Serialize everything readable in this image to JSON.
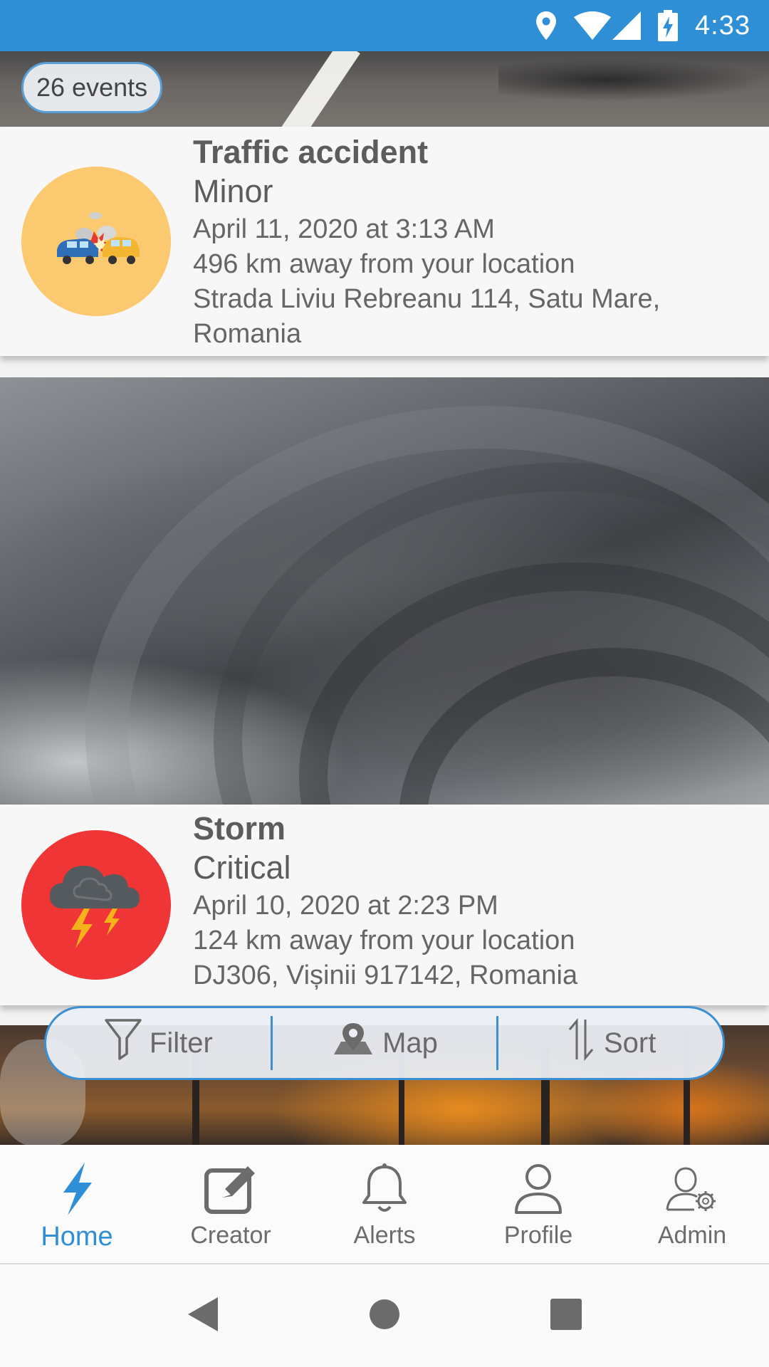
{
  "status_bar": {
    "time": "4:33",
    "icons": [
      "location-icon",
      "wifi-icon",
      "signal-icon",
      "battery-charging-icon"
    ],
    "background": "#2f8fd6"
  },
  "events_count": "26 events",
  "cards": [
    {
      "title": "Traffic accident",
      "severity": "Minor",
      "datetime": "April 11, 2020 at 3:13 AM",
      "distance": "496 km away from your location",
      "address": "Strada Liviu Rebreanu 114, Satu Mare, Romania",
      "icon": "car-crash-icon",
      "icon_bg": "#fbc96f"
    },
    {
      "title": "Storm",
      "severity": "Critical",
      "datetime": "April 10, 2020 at 2:23 PM",
      "distance": "124 km away from your location",
      "address": "DJ306, Vișinii 917142, Romania",
      "icon": "storm-cloud-icon",
      "icon_bg": "#ef3535"
    }
  ],
  "toolbar": {
    "filter_label": "Filter",
    "map_label": "Map",
    "sort_label": "Sort",
    "accent": "#3d8fd4"
  },
  "bottom_nav": {
    "items": [
      {
        "label": "Home",
        "icon": "lightning-icon",
        "active": true
      },
      {
        "label": "Creator",
        "icon": "edit-icon",
        "active": false
      },
      {
        "label": "Alerts",
        "icon": "bell-icon",
        "active": false
      },
      {
        "label": "Profile",
        "icon": "user-icon",
        "active": false
      },
      {
        "label": "Admin",
        "icon": "admin-gear-icon",
        "active": false
      }
    ],
    "active_color": "#2f8fd6"
  },
  "system_nav": [
    "back-icon",
    "home-circle-icon",
    "recents-square-icon"
  ]
}
